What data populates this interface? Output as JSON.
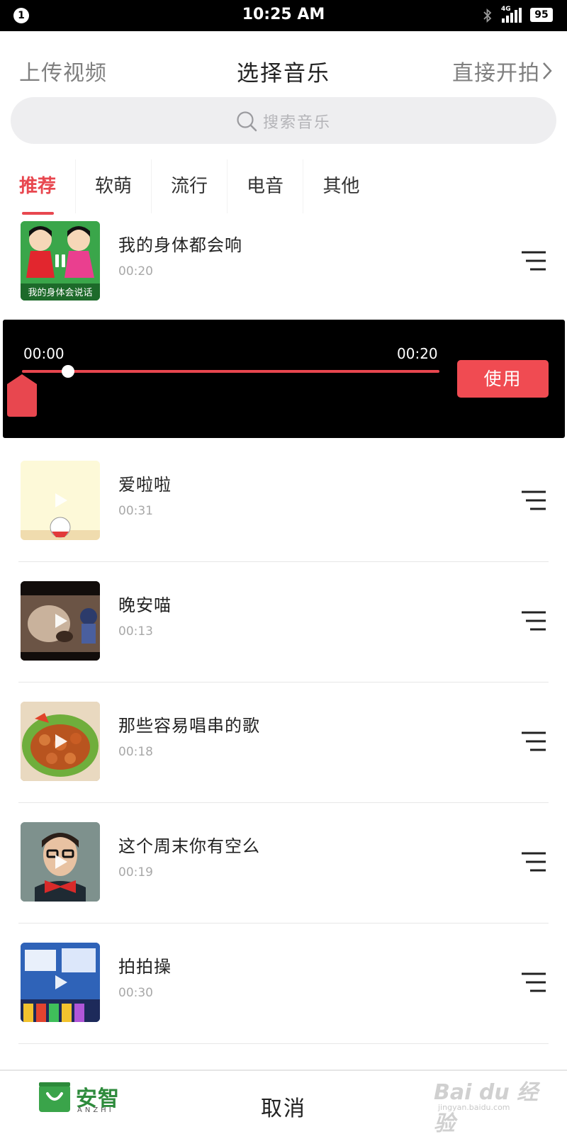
{
  "status_bar": {
    "notification_count": "1",
    "time": "10:25 AM",
    "network": "4G",
    "battery": "95"
  },
  "header": {
    "left": "上传视频",
    "title": "选择音乐",
    "right": "直接开拍"
  },
  "search": {
    "placeholder": "搜索音乐"
  },
  "tabs": [
    {
      "label": "推荐",
      "active": true
    },
    {
      "label": "软萌",
      "active": false
    },
    {
      "label": "流行",
      "active": false
    },
    {
      "label": "电音",
      "active": false
    },
    {
      "label": "其他",
      "active": false
    }
  ],
  "songs": [
    {
      "title": "我的身体都会响",
      "duration": "00:20",
      "thumb_text": "我的身体会说话",
      "state": "playing"
    },
    {
      "title": "爱啦啦",
      "duration": "00:31",
      "state": "paused"
    },
    {
      "title": "晚安喵",
      "duration": "00:13",
      "state": "paused"
    },
    {
      "title": "那些容易唱串的歌",
      "duration": "00:18",
      "state": "paused"
    },
    {
      "title": "这个周末你有空么",
      "duration": "00:19",
      "state": "paused"
    },
    {
      "title": "拍拍操",
      "duration": "00:30",
      "state": "paused"
    }
  ],
  "player": {
    "start_time": "00:00",
    "end_time": "00:20",
    "progress": 0.11,
    "use_label": "使用"
  },
  "bottom": {
    "cancel": "取消",
    "logo_cn": "安智",
    "logo_en": "ANZHI"
  },
  "watermark": {
    "main": "Bai du 经验",
    "sub": "jingyan.baidu.com"
  },
  "colors": {
    "accent": "#e8474f",
    "button": "#f04b52",
    "player_bg": "#000000",
    "search_bg": "#eeeef0"
  }
}
